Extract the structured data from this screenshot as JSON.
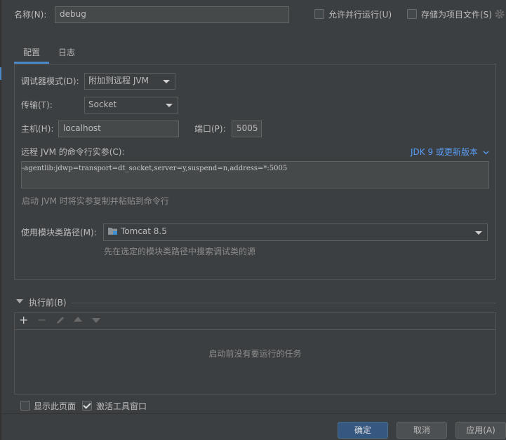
{
  "header": {
    "name_label": "名称(N):",
    "name_value": "debug",
    "allow_parallel_label": "允许并行运行(U)",
    "store_as_project_label": "存储为项目文件(S)"
  },
  "tabs": [
    {
      "label": "配置",
      "active": true
    },
    {
      "label": "日志",
      "active": false
    }
  ],
  "config": {
    "debugger_mode_label": "调试器模式(D):",
    "debugger_mode_value": "附加到远程 JVM",
    "transport_label": "传输(T):",
    "transport_value": "Socket",
    "host_label": "主机(H):",
    "host_value": "localhost",
    "port_label": "端口(P):",
    "port_value": "5005",
    "cmd_args_label": "远程 JVM 的命令行实参(C):",
    "jdk_version_link": "JDK 9 或更新版本",
    "cmd_args_value": "-agentlib:jdwp=transport=dt_socket,server=y,suspend=n,address=*:5005",
    "cmd_args_hint": "启动 JVM 时将实参复制并粘贴到命令行",
    "module_classpath_label": "使用模块类路径(M):",
    "module_classpath_value": "Tomcat 8.5",
    "module_classpath_hint": "先在选定的模块类路径中搜索调试类的源"
  },
  "before_launch": {
    "title": "执行前(B)",
    "empty_text": "启动前没有要运行的任务"
  },
  "footer": {
    "show_page_label": "显示此页面",
    "activate_tool_window_label": "激活工具窗口",
    "ok_label": "确定",
    "cancel_label": "取消",
    "apply_label": "应用(A)"
  },
  "colors": {
    "background": "#3c3f41",
    "accent_tab": "#4a88c7",
    "link": "#589df6",
    "primary_button": "#365880"
  }
}
